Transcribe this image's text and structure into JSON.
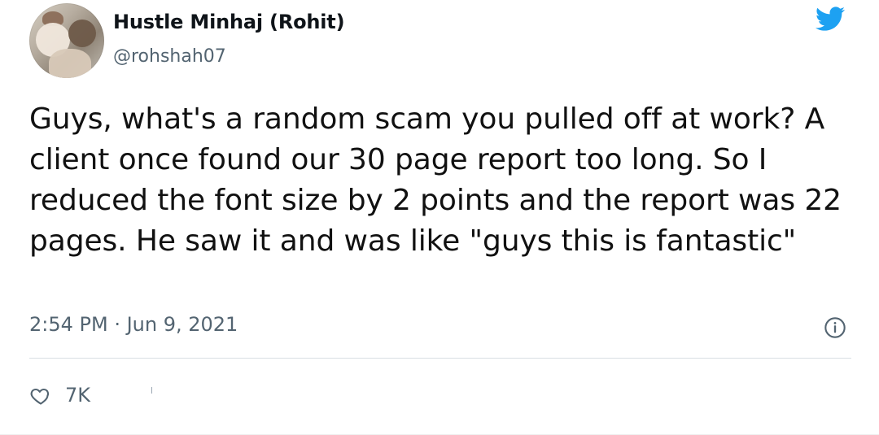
{
  "tweet": {
    "author": {
      "name": "Hustle Minhaj (Rohit)",
      "handle": "@rohshah07"
    },
    "text": "Guys, what's a random scam you pulled off at work? A client once found our 30 page report too long. So I reduced the font size by 2 points and the report was 22 pages. He saw it and was like \"guys this is fantastic\"",
    "timestamp": "2:54 PM · Jun 9, 2021",
    "likes": "7K",
    "icons": {
      "twitter": "twitter-bird-icon",
      "info": "info-icon",
      "like": "heart-icon"
    },
    "colors": {
      "brand": "#1DA1F2",
      "text": "#111111",
      "muted": "#536471",
      "divider": "#D9DEE3"
    }
  }
}
